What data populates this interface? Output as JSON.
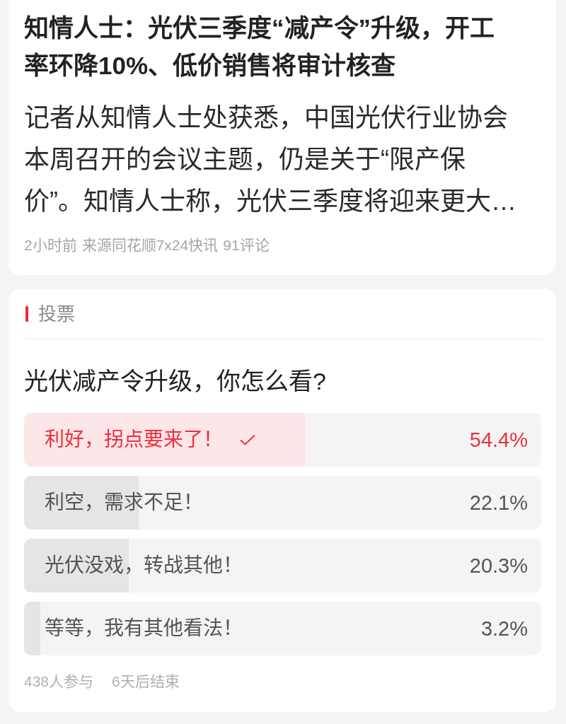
{
  "article": {
    "title": "知情人士：光伏三季度“减产令”升级，开工率环降10%、低价销售将审计核查",
    "summary": "记者从知情人士处获悉，中国光伏行业协会本周召开的会议主题，仍是关于“限产保价”。知情人士称，光伏三季度将迎来更大…",
    "meta": {
      "time": "2小时前",
      "source": "来源同花顺7x24快讯",
      "comments": "91评论"
    }
  },
  "poll": {
    "section_label": "投票",
    "question": "光伏减产令升级，你怎么看?",
    "options": [
      {
        "label": "利好，拐点要来了！",
        "percent": "54.4%",
        "level": 0.544,
        "selected": true
      },
      {
        "label": "利空，需求不足！",
        "percent": "22.1%",
        "level": 0.221,
        "selected": false
      },
      {
        "label": "光伏没戏，转战其他！",
        "percent": "20.3%",
        "level": 0.203,
        "selected": false
      },
      {
        "label": "等等，我有其他看法！",
        "percent": "3.2%",
        "level": 0.032,
        "selected": false
      }
    ],
    "participants": "438人参与",
    "deadline": "6天后结束"
  }
}
